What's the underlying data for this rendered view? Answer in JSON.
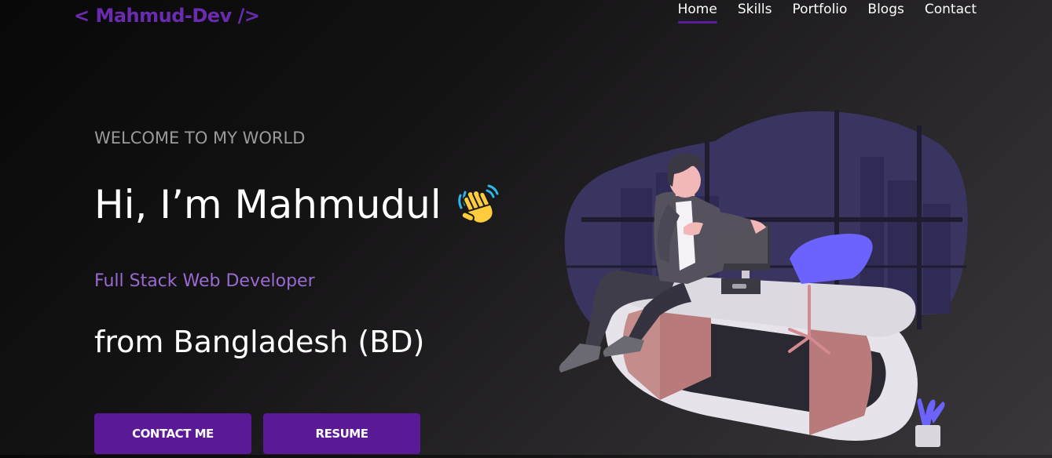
{
  "nav": {
    "logo": "< Mahmud-Dev />",
    "links": [
      "Home",
      "Skills",
      "Portfolio",
      "Blogs",
      "Contact"
    ],
    "active": "Home"
  },
  "hero": {
    "welcome": "WELCOME TO MY WORLD",
    "greeting": "Hi, I’m Mahmudul",
    "wave_icon": "waving-hand",
    "role": "Full Stack Web Developer",
    "location": "from Bangladesh (BD)",
    "buttons": {
      "contact": "CONTACT ME",
      "resume": "RESUME"
    }
  },
  "colors": {
    "accent": "#5a1997",
    "logo": "#6a2bb0",
    "role_text": "#9b6ad1",
    "illustration_bg": "#3a3560",
    "chair": "#6c63ff"
  }
}
